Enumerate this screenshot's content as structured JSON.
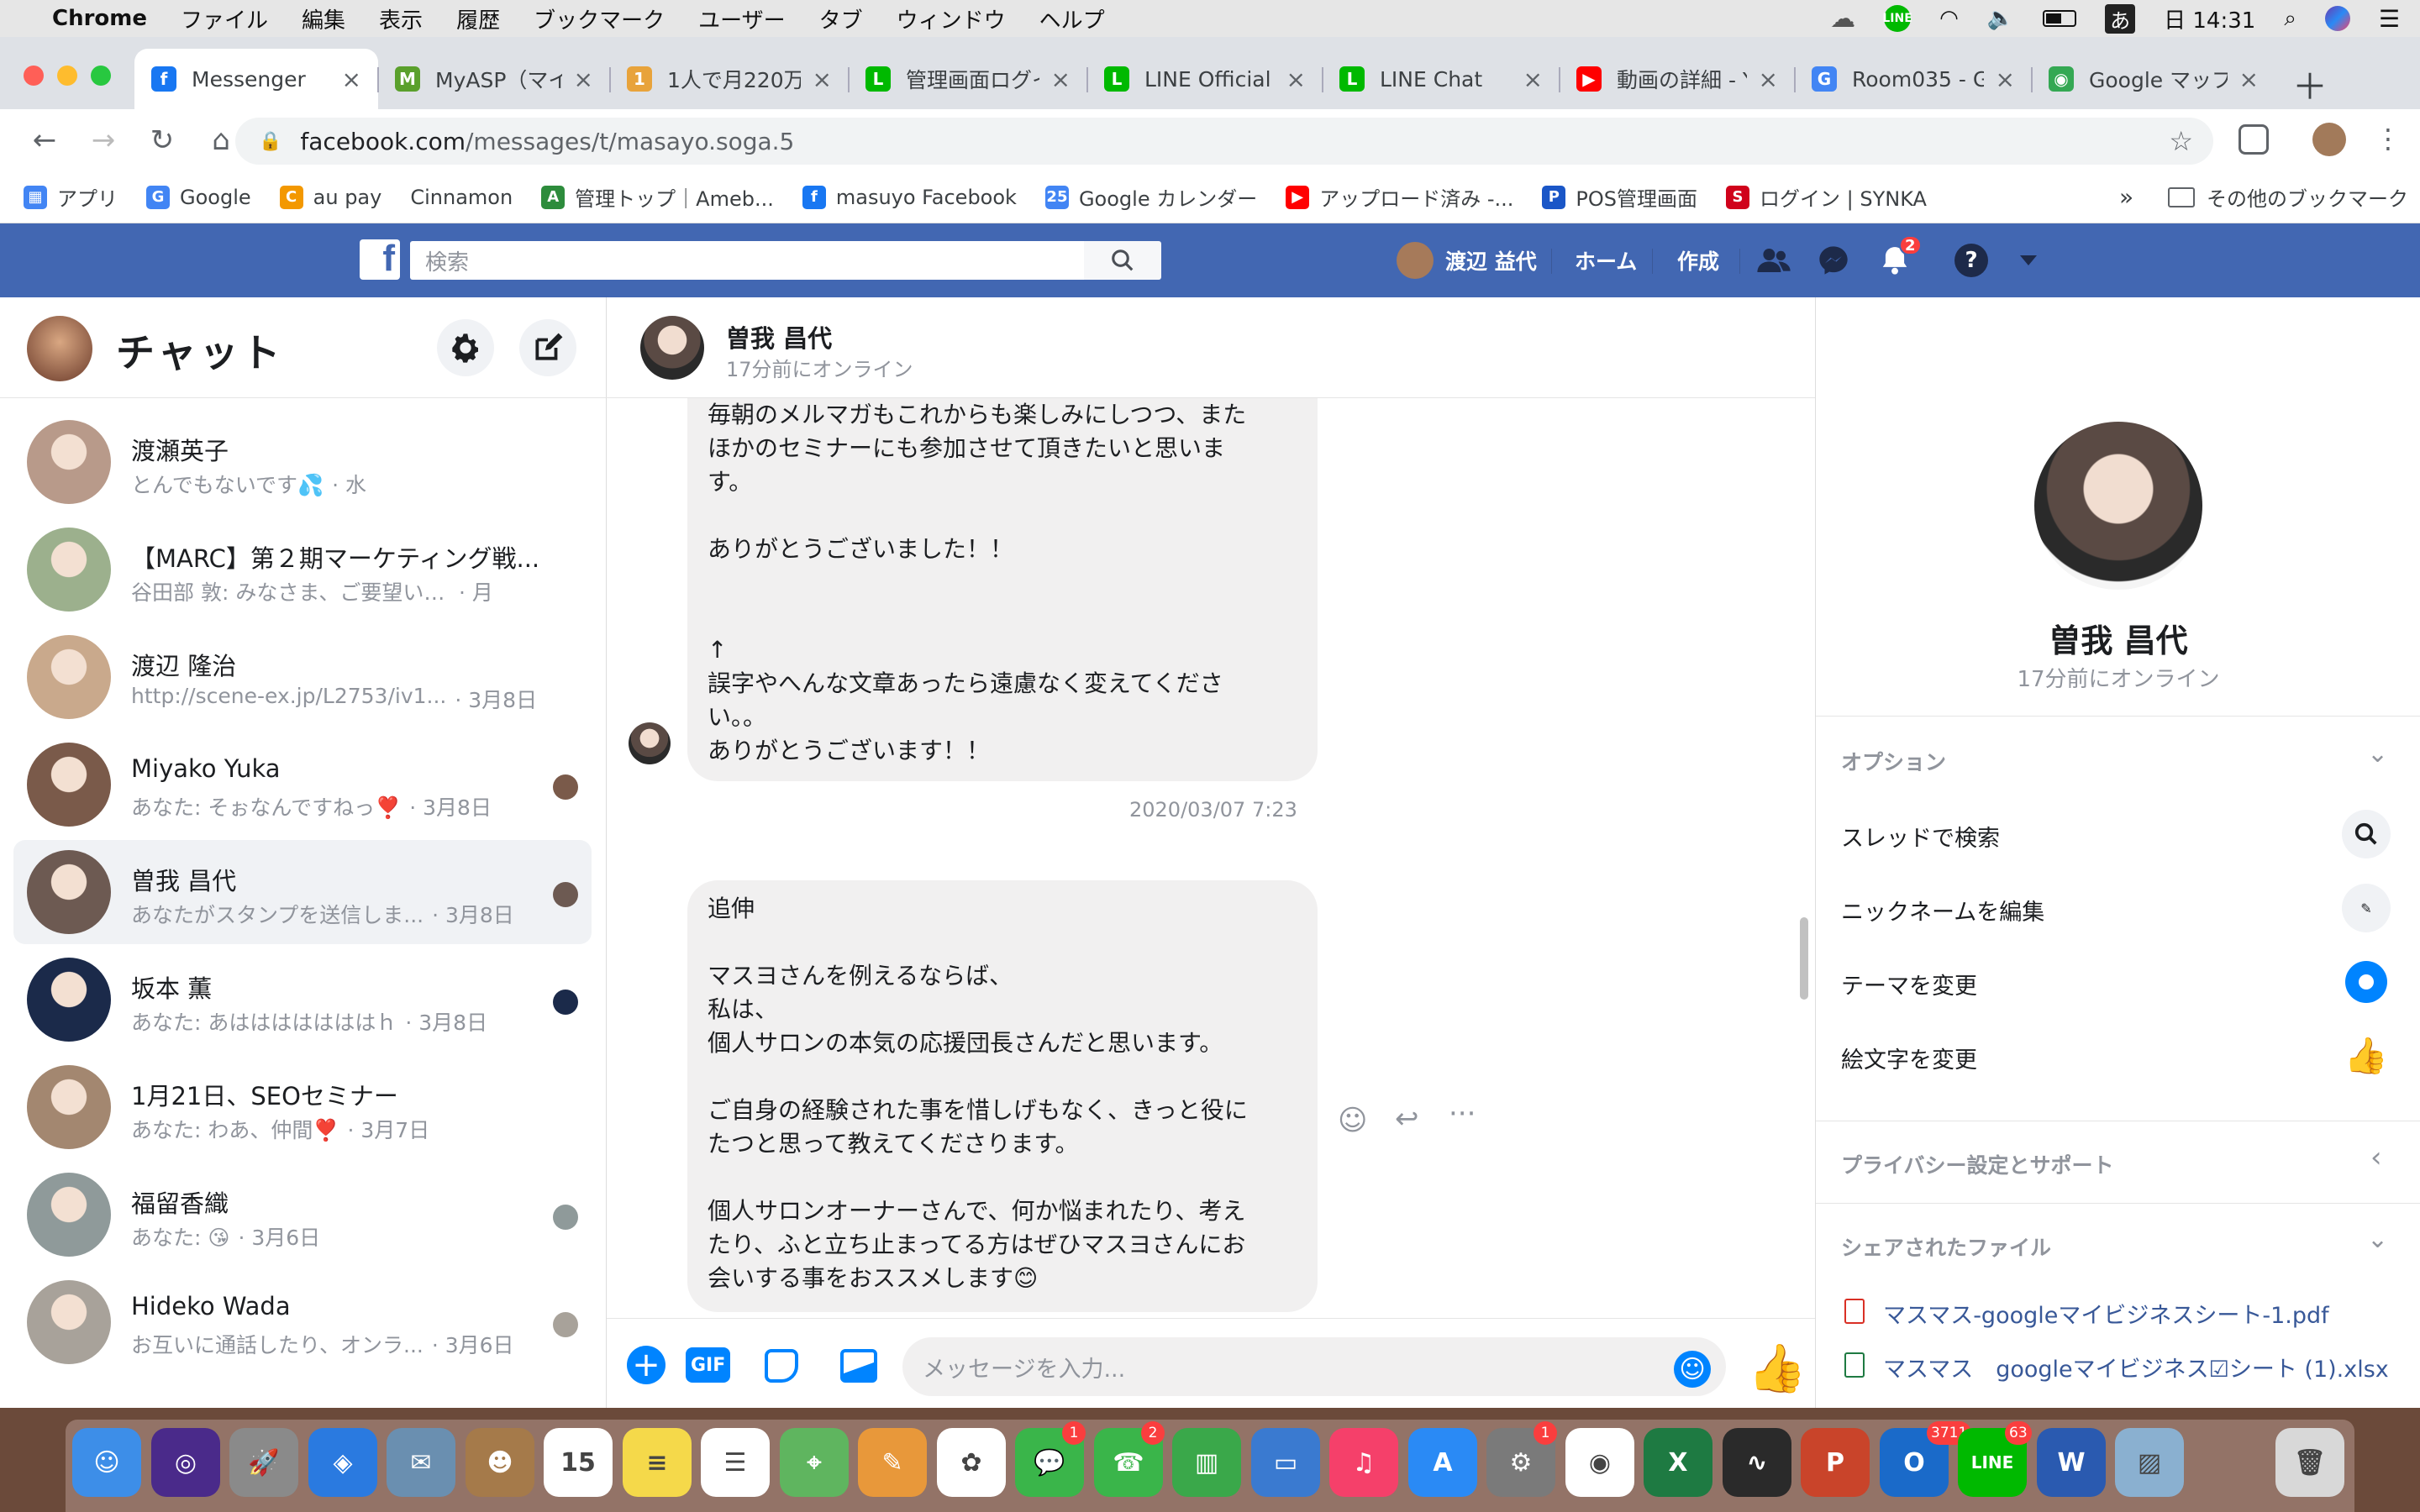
{
  "menubar": {
    "app": "Chrome",
    "items": [
      "ファイル",
      "編集",
      "表示",
      "履歴",
      "ブックマーク",
      "ユーザー",
      "タブ",
      "ウィンドウ",
      "ヘルプ"
    ],
    "input_mode": "あ",
    "clock": "日 14:31"
  },
  "tabs": [
    {
      "title": "Messenger",
      "color": "#1877f2",
      "glyph": "f"
    },
    {
      "title": "MyASP（マイ...",
      "color": "#5aa02c",
      "glyph": "M"
    },
    {
      "title": "1人で月220万",
      "color": "#e8a33b",
      "glyph": "1"
    },
    {
      "title": "管理画面ログイ",
      "color": "#00b900",
      "glyph": "L"
    },
    {
      "title": "LINE Official A",
      "color": "#00b900",
      "glyph": "L"
    },
    {
      "title": "LINE Chat",
      "color": "#00b900",
      "glyph": "L"
    },
    {
      "title": "動画の詳細 - Y",
      "color": "#ff0000",
      "glyph": "▶"
    },
    {
      "title": "Room035 - G",
      "color": "#4285f4",
      "glyph": "G"
    },
    {
      "title": "Google マップ",
      "color": "#34a853",
      "glyph": "◉"
    }
  ],
  "address": {
    "host": "facebook.com",
    "path": "/messages/t/masayo.soga.5"
  },
  "bookmarks": [
    {
      "label": "アプリ",
      "color": "#4285f4",
      "glyph": "▦"
    },
    {
      "label": "Google",
      "color": "#4285f4",
      "glyph": "G"
    },
    {
      "label": "au pay",
      "color": "#f39800",
      "glyph": "C"
    },
    {
      "label": "Cinnamon",
      "color": "#ffffff",
      "glyph": ""
    },
    {
      "label": "管理トップ｜Ameb...",
      "color": "#2d8c3c",
      "glyph": "A"
    },
    {
      "label": "masuyo Facebook",
      "color": "#1877f2",
      "glyph": "f"
    },
    {
      "label": "Google カレンダー",
      "color": "#4285f4",
      "glyph": "25"
    },
    {
      "label": "アップロード済み -...",
      "color": "#ff0000",
      "glyph": "▶"
    },
    {
      "label": "POS管理画面",
      "color": "#1a56c7",
      "glyph": "P"
    },
    {
      "label": "ログイン | SYNKA",
      "color": "#d0021b",
      "glyph": "S"
    }
  ],
  "bookmarks_other": "その他のブックマーク",
  "fb": {
    "search_placeholder": "検索",
    "user_name": "渡辺 益代",
    "home": "ホーム",
    "create": "作成",
    "notif_count": "2"
  },
  "left": {
    "title": "チャット",
    "conversations": [
      {
        "name": "渡瀬英子",
        "preview": "とんでもないです💦",
        "date": "· 水",
        "color": "#b89a8a",
        "selected": false,
        "mini": false
      },
      {
        "name": "【MARC】第２期マーケティング戦...",
        "preview": "谷田部 敦: みなさま、ご要望いた...",
        "date": "· 月",
        "color": "#9cb08d",
        "selected": false,
        "mini": false
      },
      {
        "name": "渡辺 隆治",
        "preview": "http://scene-ex.jp/L2753/iv1...",
        "date": "· 3月8日",
        "color": "#c9a98c",
        "selected": false,
        "mini": false
      },
      {
        "name": "Miyako Yuka",
        "preview": "あなた: そぉなんですねっ❣️",
        "date": "· 3月8日",
        "color": "#7a5a4a",
        "selected": false,
        "mini": true
      },
      {
        "name": "曽我 昌代",
        "preview": "あなたがスタンプを送信しま...",
        "date": "· 3月8日",
        "color": "#6d5a52",
        "selected": true,
        "mini": true
      },
      {
        "name": "坂本 薫",
        "preview": "あなた: あはははははははｈ",
        "date": "· 3月8日",
        "color": "#1b2a4a",
        "selected": false,
        "mini": true
      },
      {
        "name": "1月21日、SEOセミナー",
        "preview": "あなた: わあ、仲間❣️",
        "date": "· 3月7日",
        "color": "#a38770",
        "selected": false,
        "mini": false
      },
      {
        "name": "福留香織",
        "preview": "あなた: 😘",
        "date": "· 3月6日",
        "color": "#8f9a9a",
        "selected": false,
        "mini": true
      },
      {
        "name": "Hideko Wada",
        "preview": "お互いに通話したり、オンラ...",
        "date": "· 3月6日",
        "color": "#a8a29a",
        "selected": false,
        "mini": true
      }
    ]
  },
  "chat": {
    "name": "曽我 昌代",
    "status": "17分前にオンライン",
    "bubble1_lines": [
      "毎朝のメルマガもこれからも楽しみにしつつ、また",
      "ほかのセミナーにも参加させて頂きたいと思いま",
      "す。",
      "",
      "ありがとうございました！！",
      "",
      "",
      "↑",
      "誤字やへんな文章あったら遠慮なく変えてくださ",
      "い。。",
      "ありがとうございます！！"
    ],
    "timestamp": "2020/03/07 7:23",
    "bubble2_lines": [
      "追伸",
      "",
      "マスヨさんを例えるならば、",
      "私は、",
      "個人サロンの本気の応援団長さんだと思います。",
      "",
      "ご自身の経験された事を惜しげもなく、きっと役に",
      "たつと思って教えてくださります。",
      "",
      "個人サロンオーナーさんで、何か悩まれたり、考え",
      "たり、ふと立ち止まってる方はぜひマスヨさんにお",
      "会いする事をおススメします😊"
    ],
    "input_placeholder": "メッセージを入力...",
    "gif_label": "GIF"
  },
  "right": {
    "name": "曽我 昌代",
    "status": "17分前にオンライン",
    "options_title": "オプション",
    "options": [
      "スレッドで検索",
      "ニックネームを編集",
      "テーマを変更",
      "絵文字を変更"
    ],
    "privacy_title": "プライバシー設定とサポート",
    "files_title": "シェアされたファイル",
    "files": [
      {
        "name": "マスマス-googleマイビジネスシート-1.pdf",
        "kind": "pdf"
      },
      {
        "name": "マスマス　googleマイビジネス☑シート (1).xlsx",
        "kind": "xlsx"
      }
    ]
  },
  "dock": [
    {
      "name": "finder",
      "color": "#3d8ee8",
      "glyph": "☺",
      "badge": ""
    },
    {
      "name": "siri",
      "color": "#4a2a8a",
      "glyph": "◎",
      "badge": ""
    },
    {
      "name": "launchpad",
      "color": "#8a8a8a",
      "glyph": "🚀",
      "badge": ""
    },
    {
      "name": "safari",
      "color": "#2a7ae0",
      "glyph": "◈",
      "badge": ""
    },
    {
      "name": "mail-stamp",
      "color": "#6a8fb0",
      "glyph": "✉",
      "badge": ""
    },
    {
      "name": "contacts",
      "color": "#a57a4a",
      "glyph": "☻",
      "badge": ""
    },
    {
      "name": "calendar",
      "color": "#ffffff",
      "glyph": "15",
      "badge": ""
    },
    {
      "name": "notes",
      "color": "#f5d94a",
      "glyph": "≡",
      "badge": ""
    },
    {
      "name": "reminders",
      "color": "#ffffff",
      "glyph": "☰",
      "badge": ""
    },
    {
      "name": "maps",
      "color": "#5fb55f",
      "glyph": "⌖",
      "badge": ""
    },
    {
      "name": "pages",
      "color": "#e8983a",
      "glyph": "✎",
      "badge": ""
    },
    {
      "name": "photos",
      "color": "#ffffff",
      "glyph": "✿",
      "badge": ""
    },
    {
      "name": "messages",
      "color": "#3ab54a",
      "glyph": "💬",
      "badge": "1"
    },
    {
      "name": "facetime",
      "color": "#3ab54a",
      "glyph": "☎",
      "badge": "2"
    },
    {
      "name": "numbers",
      "color": "#3aa84a",
      "glyph": "▥",
      "badge": ""
    },
    {
      "name": "keynote",
      "color": "#3a7ad0",
      "glyph": "▭",
      "badge": ""
    },
    {
      "name": "music",
      "color": "#f5406a",
      "glyph": "♫",
      "badge": ""
    },
    {
      "name": "app-store",
      "color": "#2a8af5",
      "glyph": "A",
      "badge": ""
    },
    {
      "name": "system-preferences",
      "color": "#7a7a7a",
      "glyph": "⚙",
      "badge": "1"
    },
    {
      "name": "chrome",
      "color": "#ffffff",
      "glyph": "◉",
      "badge": ""
    },
    {
      "name": "excel",
      "color": "#1e7a42",
      "glyph": "X",
      "badge": ""
    },
    {
      "name": "activity-monitor",
      "color": "#2a2a2a",
      "glyph": "∿",
      "badge": ""
    },
    {
      "name": "powerpoint",
      "color": "#c9442a",
      "glyph": "P",
      "badge": ""
    },
    {
      "name": "outlook",
      "color": "#1a6ac9",
      "glyph": "O",
      "badge": "3711"
    },
    {
      "name": "line",
      "color": "#00b900",
      "glyph": "LINE",
      "badge": "63"
    },
    {
      "name": "word",
      "color": "#2a5ab0",
      "glyph": "W",
      "badge": ""
    },
    {
      "name": "preview",
      "color": "#8ab0d0",
      "glyph": "▨",
      "badge": ""
    },
    {
      "name": "trash",
      "color": "#d8d8d8",
      "glyph": "🗑",
      "badge": ""
    }
  ]
}
